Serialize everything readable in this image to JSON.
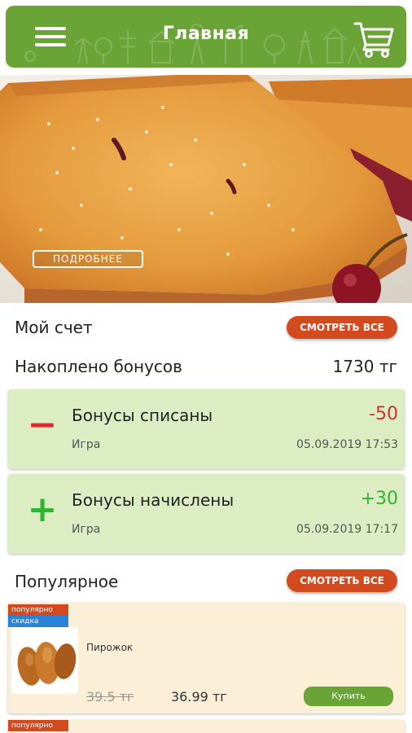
{
  "header": {
    "title": "Главная",
    "menu_icon": "hamburger-menu-icon",
    "cart_icon": "cart-icon"
  },
  "banner": {
    "more_label": "ПОДРОБНЕЕ"
  },
  "account": {
    "title": "Мой счет",
    "see_all": "СМОТРЕТЬ ВСЕ",
    "bonus_label": "Накоплено бонусов",
    "bonus_value": "1730 тг"
  },
  "transactions": [
    {
      "sign": "−",
      "title": "Бонусы списаны",
      "source": "Игра",
      "amount": "-50",
      "date": "05.09.2019 17:53",
      "color": "#d32f2f"
    },
    {
      "sign": "+",
      "title": "Бонусы начислены",
      "source": "Игра",
      "amount": "+30",
      "date": "05.09.2019 17:17",
      "color": "#2fb52f"
    }
  ],
  "popular": {
    "title": "Популярное",
    "see_all": "СМОТРЕТЬ ВСЕ",
    "products": [
      {
        "badge_popular": "популярно",
        "badge_sale": "скидка",
        "name": "Пирожок",
        "old_price": "39.5 тг",
        "new_price": "36.99 тг",
        "buy_label": "Купить"
      },
      {
        "badge_popular": "популярно"
      }
    ]
  },
  "colors": {
    "accent_green": "#6aa336",
    "accent_orange": "#d24a1e",
    "card_green": "#dcedc4",
    "card_cream": "#fcefd8"
  }
}
